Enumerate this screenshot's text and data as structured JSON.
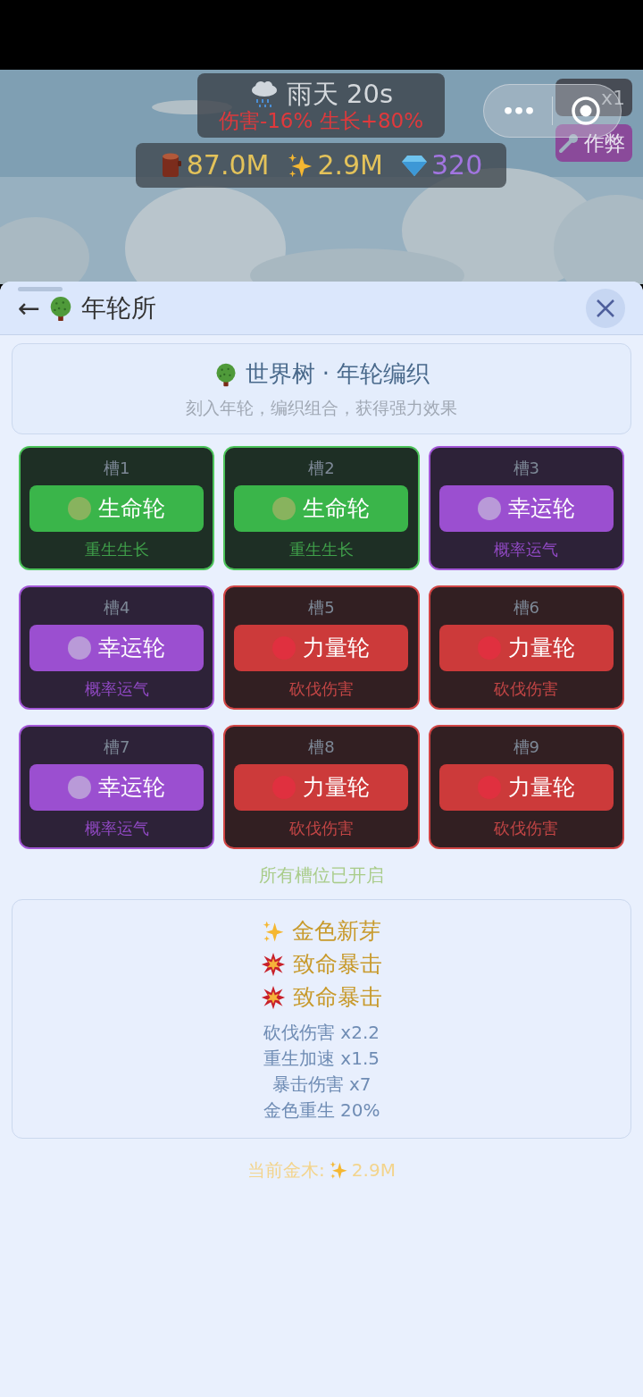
{
  "hud": {
    "weather": "雨天 20s",
    "weather_effect": "伤害-16% 生长+80%",
    "resources": [
      {
        "kind": "wood",
        "value": "87.0M"
      },
      {
        "kind": "gold",
        "value": "2.9M"
      },
      {
        "kind": "gem",
        "value": "320"
      }
    ],
    "speed_button": "x1",
    "cheat_button": "作弊",
    "capsule": {
      "more": "•••"
    }
  },
  "panel": {
    "back": "←",
    "title": "年轮所",
    "intro": {
      "title": "世界树 · 年轮编织",
      "subtitle": "刻入年轮，编织组合，获得强力效果"
    },
    "slots": [
      {
        "label": "槽1",
        "kind": "life",
        "ring": "生命轮",
        "effect": "重生生长"
      },
      {
        "label": "槽2",
        "kind": "life",
        "ring": "生命轮",
        "effect": "重生生长"
      },
      {
        "label": "槽3",
        "kind": "luck",
        "ring": "幸运轮",
        "effect": "概率运气"
      },
      {
        "label": "槽4",
        "kind": "luck",
        "ring": "幸运轮",
        "effect": "概率运气"
      },
      {
        "label": "槽5",
        "kind": "power",
        "ring": "力量轮",
        "effect": "砍伐伤害"
      },
      {
        "label": "槽6",
        "kind": "power",
        "ring": "力量轮",
        "effect": "砍伐伤害"
      },
      {
        "label": "槽7",
        "kind": "luck",
        "ring": "幸运轮",
        "effect": "概率运气"
      },
      {
        "label": "槽8",
        "kind": "power",
        "ring": "力量轮",
        "effect": "砍伐伤害"
      },
      {
        "label": "槽9",
        "kind": "power",
        "ring": "力量轮",
        "effect": "砍伐伤害"
      }
    ],
    "slots_status": "所有槽位已开启",
    "combos": [
      {
        "kind": "sparkle",
        "name": "金色新芽"
      },
      {
        "kind": "burst",
        "name": "致命暴击"
      },
      {
        "kind": "burst",
        "name": "致命暴击"
      }
    ],
    "stats": [
      "砍伐伤害 x2.2",
      "重生加速 x1.5",
      "暴击伤害 x7",
      "金色重生 20%"
    ],
    "current_gold": {
      "label": "当前金木:",
      "value": "2.9M"
    }
  }
}
